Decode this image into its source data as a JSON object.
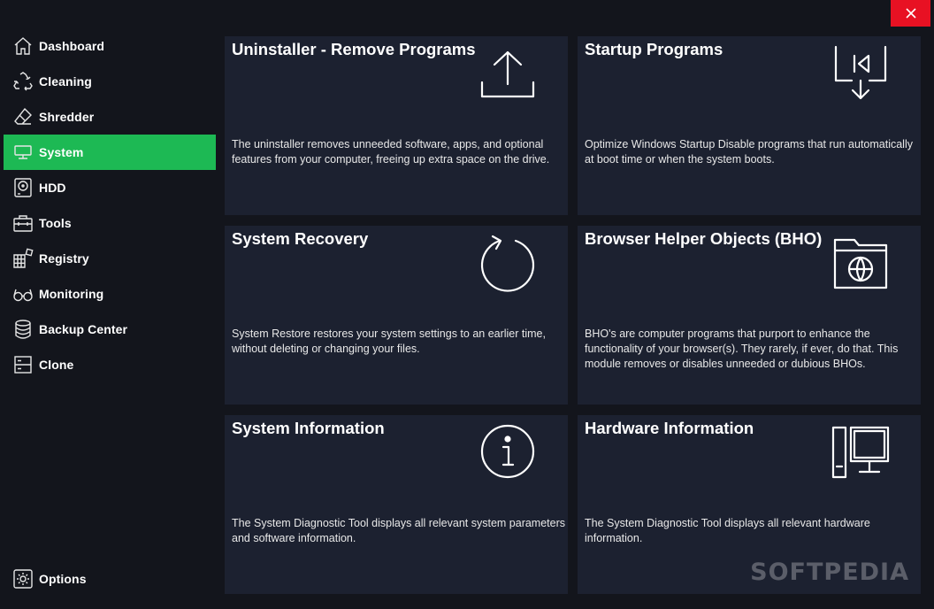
{
  "window": {
    "close_label": "×"
  },
  "sidebar": {
    "items": [
      {
        "label": "Dashboard",
        "icon": "home-icon",
        "active": false
      },
      {
        "label": "Cleaning",
        "icon": "recycle-icon",
        "active": false
      },
      {
        "label": "Shredder",
        "icon": "eraser-icon",
        "active": false
      },
      {
        "label": "System",
        "icon": "system-icon",
        "active": true
      },
      {
        "label": "HDD",
        "icon": "hdd-icon",
        "active": false
      },
      {
        "label": "Tools",
        "icon": "toolbox-icon",
        "active": false
      },
      {
        "label": "Registry",
        "icon": "registry-icon",
        "active": false
      },
      {
        "label": "Monitoring",
        "icon": "glasses-icon",
        "active": false
      },
      {
        "label": "Backup Center",
        "icon": "database-icon",
        "active": false
      },
      {
        "label": "Clone",
        "icon": "clone-icon",
        "active": false
      }
    ],
    "options_label": "Options"
  },
  "cards": [
    {
      "title": "Uninstaller - Remove Programs",
      "icon": "upload-icon",
      "description": "The uninstaller removes unneeded software, apps, and optional features from your computer, freeing up extra space on the drive."
    },
    {
      "title": "Startup Programs",
      "icon": "startup-icon",
      "description": "Optimize Windows Startup Disable programs that run automatically at boot time or when the system boots."
    },
    {
      "title": "System Recovery",
      "icon": "restore-icon",
      "description": "System Restore restores your system settings to an earlier time, without deleting or changing your files."
    },
    {
      "title": "Browser Helper Objects (BHO)",
      "icon": "folder-globe-icon",
      "description": "BHO's are computer programs that purport to enhance the functionality of your browser(s). They rarely, if ever, do that. This module removes or disables unneeded or dubious BHOs."
    },
    {
      "title": "System Information",
      "icon": "info-icon",
      "description": "The System Diagnostic Tool displays all relevant system parameters and software information."
    },
    {
      "title": "Hardware Information",
      "icon": "computer-icon",
      "description": "The System Diagnostic Tool displays all relevant hardware information."
    }
  ],
  "watermark": "SOFTPEDIA",
  "colors": {
    "background": "#13151c",
    "card": "#1c2130",
    "accent": "#1db954",
    "close": "#e81123"
  }
}
